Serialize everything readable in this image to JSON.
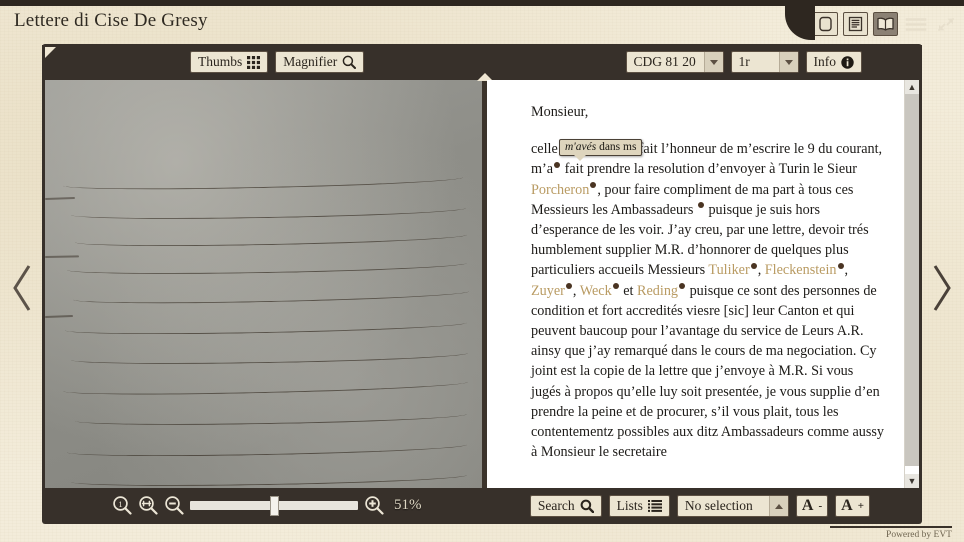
{
  "app": {
    "title": "Lettere di Cise De Gresy",
    "footer": "Powered by EVT"
  },
  "top_icons": [
    {
      "name": "single-page-view-icon",
      "glyph": "single-page"
    },
    {
      "name": "text-view-icon",
      "glyph": "text-page"
    },
    {
      "name": "book-view-icon",
      "glyph": "book",
      "active": true
    },
    {
      "name": "menu-icon",
      "glyph": "hamburger"
    },
    {
      "name": "collapse-icon",
      "glyph": "collapse-arrows"
    }
  ],
  "toolbar_top": {
    "thumbs_label": "Thumbs",
    "magnifier_label": "Magnifier",
    "document_select": "CDG 81 20",
    "page_select": "1r",
    "info_label": "Info"
  },
  "toolbar_bottom": {
    "search_label": "Search",
    "lists_label": "Lists",
    "selection_value": "No selection",
    "font_decrease_label": "A",
    "font_decrease_sup": "-",
    "font_increase_label": "A",
    "font_increase_sup": "+"
  },
  "zoom_controls": {
    "reset_title": "1",
    "percent": "51%",
    "slider_value": 51
  },
  "image_pane": {
    "alt": "handwritten manuscript folio 1r"
  },
  "text_pane": {
    "salutation": "Monsieur,",
    "tooltip": {
      "italic": "m'avés",
      "rest": " dans ms"
    },
    "body_segments": [
      {
        "t": "celle que m’avez",
        "k": "txt"
      },
      {
        "t": "•",
        "k": "pb"
      },
      {
        "t": " fait l’honneur de m’escrire le 9 du courant, m’a",
        "k": "txt"
      },
      {
        "t": "•",
        "k": "pb"
      },
      {
        "t": " fait prendre la resolution d’envoyer à Turin le Sieur ",
        "k": "txt"
      },
      {
        "t": "Porcheron",
        "k": "nm"
      },
      {
        "t": "•",
        "k": "pb"
      },
      {
        "t": ", pour faire compliment de ma part à tous ces Messieurs les Ambassadeurs ",
        "k": "txt"
      },
      {
        "t": "•",
        "k": "pb"
      },
      {
        "t": " puisque je suis hors d’esperance de les voir. J’ay creu, par une lettre, devoir trés humblement supplier M.R. d’honnorer de quelques plus particuliers accueils Messieurs ",
        "k": "txt"
      },
      {
        "t": "Tuliker",
        "k": "nm"
      },
      {
        "t": "•",
        "k": "pb"
      },
      {
        "t": ", ",
        "k": "txt"
      },
      {
        "t": "Fleckenstein",
        "k": "nm"
      },
      {
        "t": "•",
        "k": "pb"
      },
      {
        "t": ", ",
        "k": "txt"
      },
      {
        "t": "Zuyer",
        "k": "nm"
      },
      {
        "t": "•",
        "k": "pb"
      },
      {
        "t": ", ",
        "k": "txt"
      },
      {
        "t": "Weck",
        "k": "nm"
      },
      {
        "t": "•",
        "k": "pb"
      },
      {
        "t": " et ",
        "k": "txt"
      },
      {
        "t": "Reding",
        "k": "nm"
      },
      {
        "t": "•",
        "k": "pb"
      },
      {
        "t": " puisque ce sont des personnes de condition et fort accredités viesre [sic] leur Canton et qui peuvent baucoup pour l’avantage du service de Leurs A.R. ainsy que j’ay remarqué dans le cours de ma negociation. Cy joint est la copie de la lettre que j’envoye à M.R. Si vous jugés à propos qu’elle luy soit presentée, je vous supplie d’en prendre la peine et de procurer, s’il vous plait, tous les contentementz possibles aux ditz Ambassadeurs comme aussy à Monsieur le secretaire",
        "k": "txt"
      }
    ]
  },
  "navigation": {
    "prev_name": "previous-page",
    "next_name": "next-page"
  },
  "colors": {
    "toolbar_bg": "#37302a",
    "page_bg": "#f3ecda",
    "button_bg": "#ece5d2",
    "name_highlight": "#b99b63",
    "popup_marker": "#4a3422"
  }
}
